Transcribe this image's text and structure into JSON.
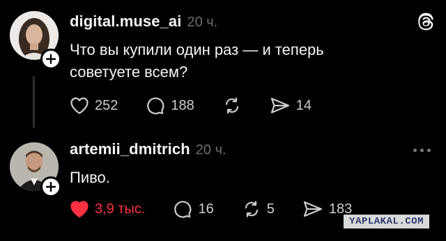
{
  "posts": [
    {
      "username": "digital.muse_ai",
      "time": "20 ч.",
      "text": "Что вы купили один раз — и теперь советуете всем?",
      "likes": "252",
      "comments": "188",
      "shares": "14"
    },
    {
      "username": "artemii_dmitrich",
      "time": "20 ч.",
      "text": "Пиво.",
      "likes": "3,9 тыс.",
      "comments": "16",
      "reposts": "5",
      "shares": "183"
    }
  ],
  "watermark": "YAPLAKAL.COM",
  "colors": {
    "background": "#000000",
    "text": "#f3f5f7",
    "muted": "#6e6e6e",
    "liked": "#ff3040"
  },
  "icons": [
    "threads-logo-icon",
    "heart-icon",
    "comment-icon",
    "repost-icon",
    "share-icon",
    "more-icon",
    "plus-icon"
  ]
}
